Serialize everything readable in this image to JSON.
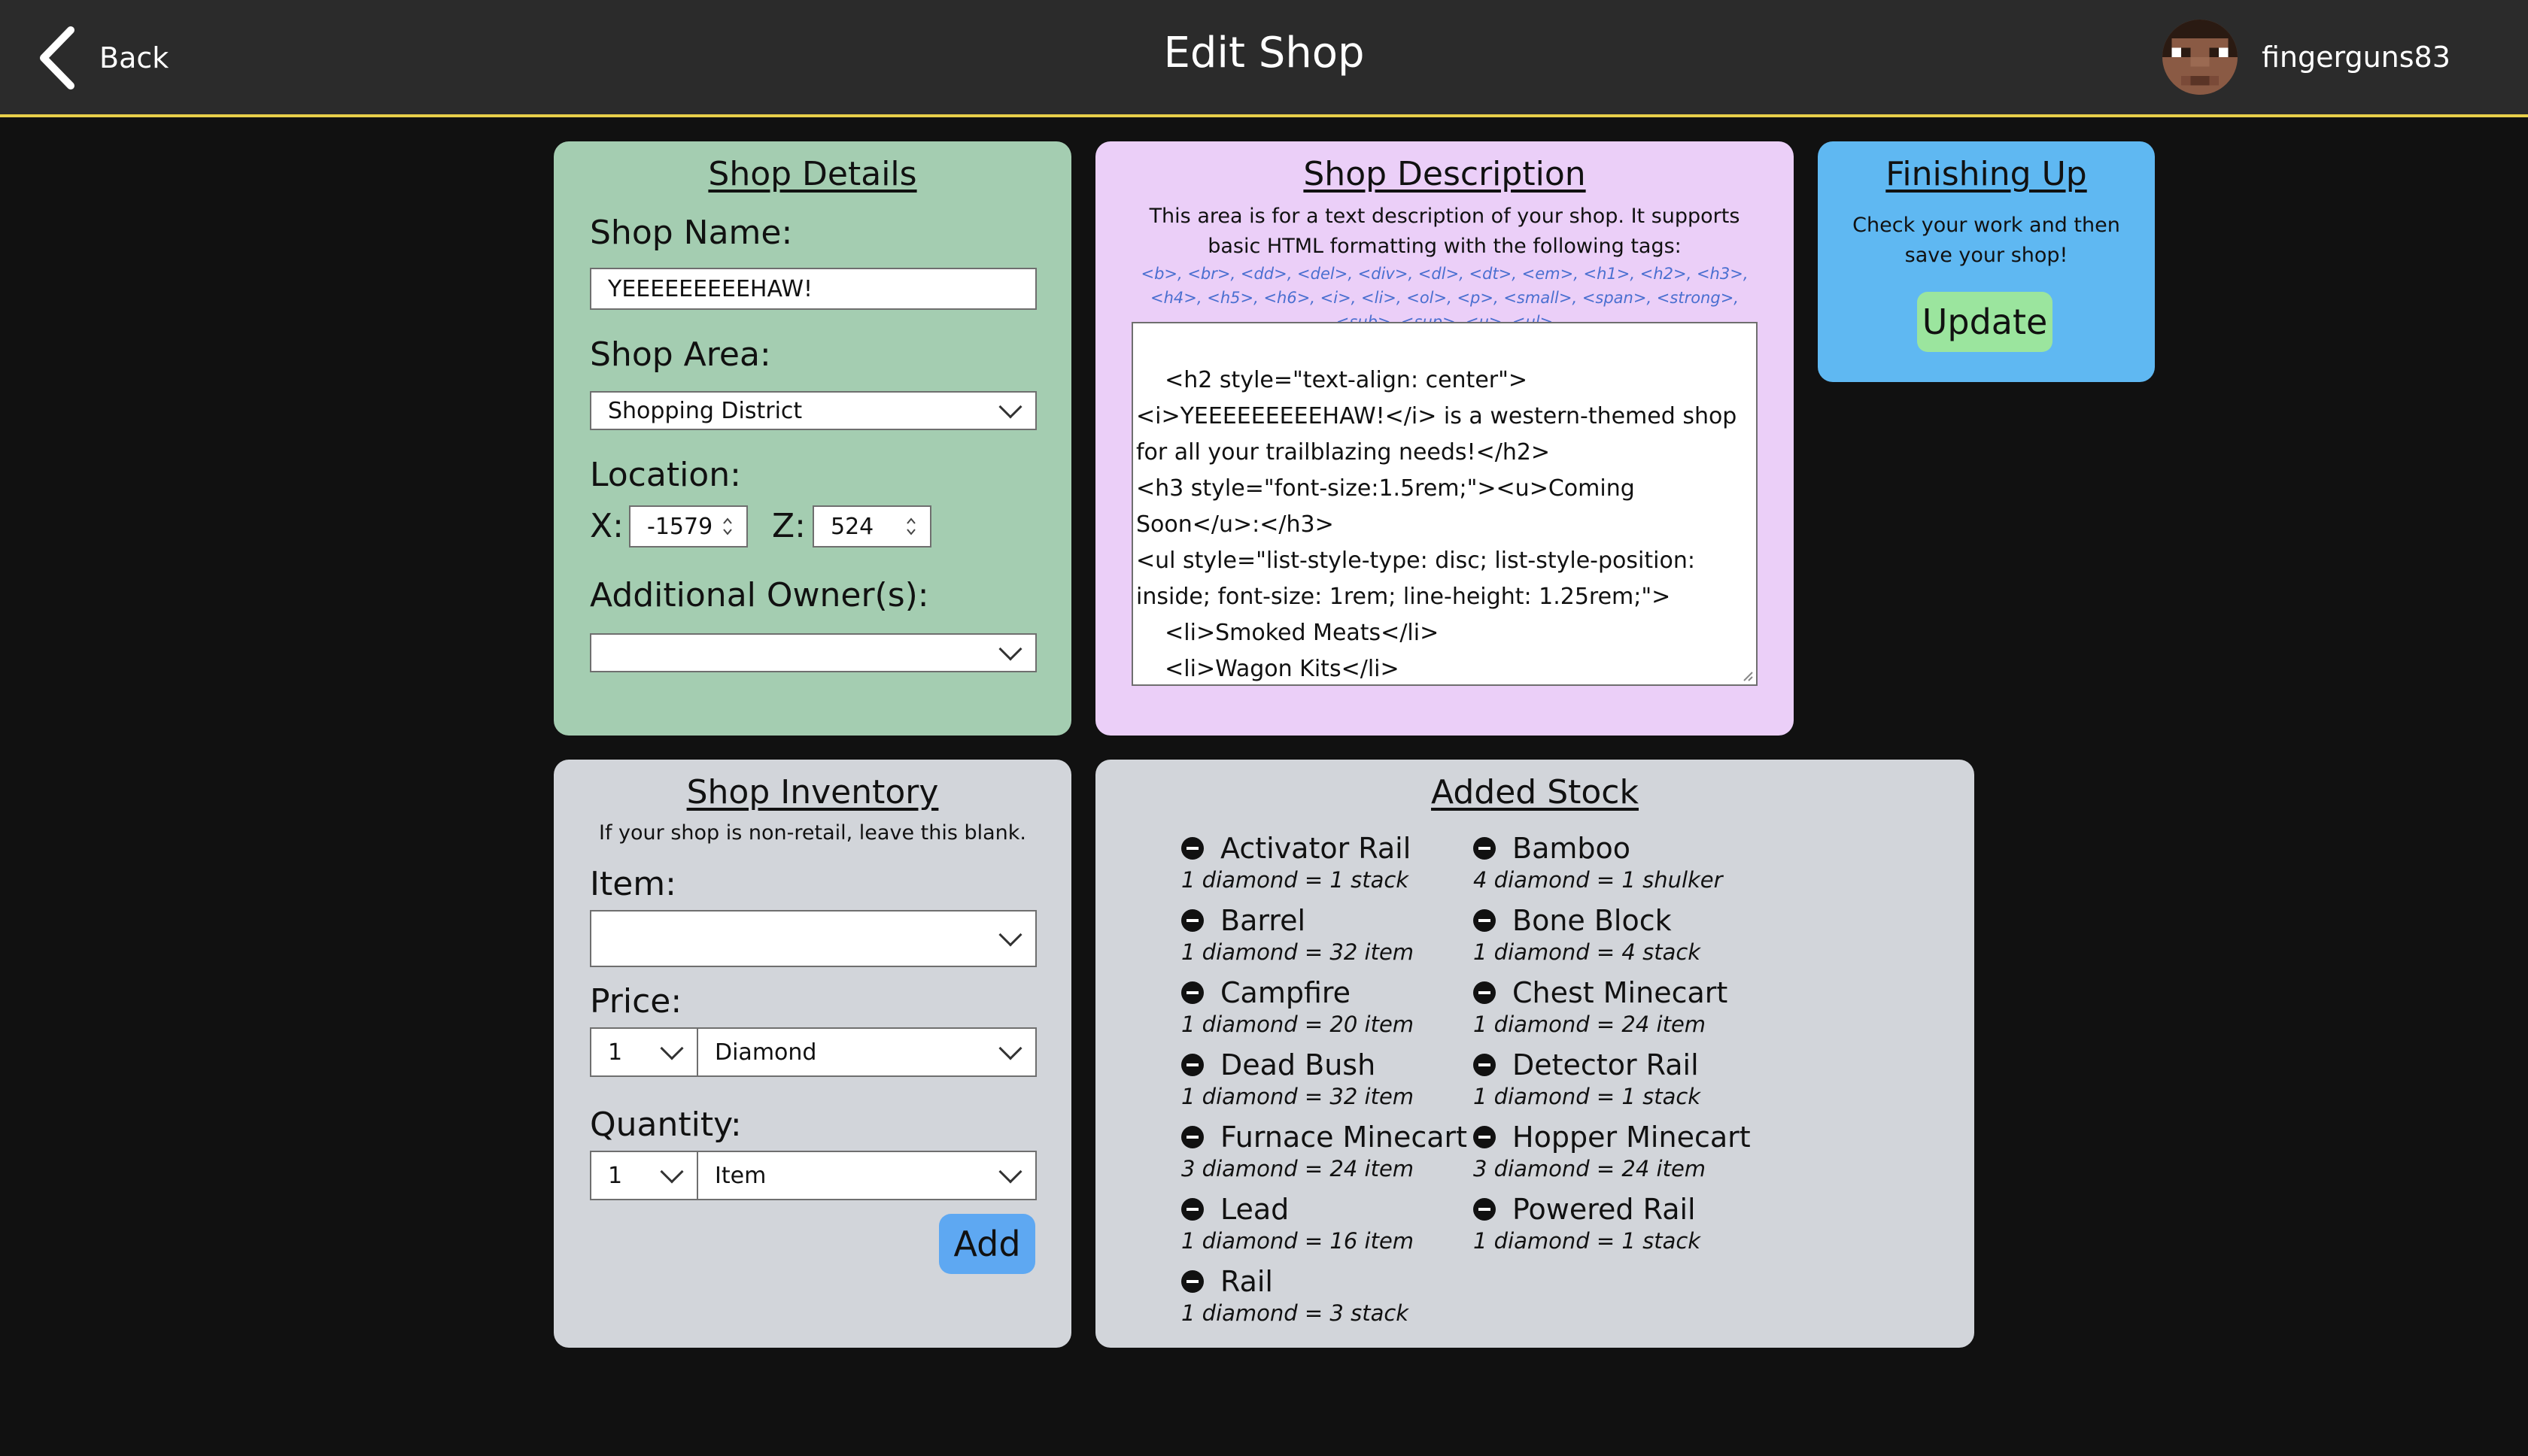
{
  "header": {
    "back_label": "Back",
    "title": "Edit Shop",
    "username": "fingerguns83"
  },
  "details": {
    "title": "Shop Details",
    "name_label": "Shop Name:",
    "name_value": "YEEEEEEEEEHAW!",
    "area_label": "Shop Area:",
    "area_value": "Shopping District",
    "location_label": "Location:",
    "x_label": "X:",
    "x_value": "-1579",
    "z_label": "Z:",
    "z_value": "524",
    "owners_label": "Additional Owner(s):",
    "owners_value": ""
  },
  "description": {
    "title": "Shop Description",
    "help": "This area is for a text description of your shop. It supports basic HTML formatting with the following tags:",
    "tags": "<b>, <br>, <dd>, <del>, <div>, <dl>, <dt>, <em>, <h1>, <h2>, <h3>, <h4>, <h5>, <h6>, <i>, <li>, <ol>, <p>, <small>, <span>, <strong>, <sub>, <sup>, <u>, <ul>",
    "text": "<h2 style=\"text-align: center\"><i>YEEEEEEEEEHAW!</i> is a western-themed shop for all your trailblazing needs!</h2>\n<h3 style=\"font-size:1.5rem;\"><u>Coming Soon</u>:</h3>\n<ul style=\"list-style-type: disc; list-style-position: inside; font-size: 1rem; line-height: 1.25rem;\">\n    <li>Smoked Meats</li>\n    <li>Wagon Kits</li>\n    <li>Cactus Boxes</li>\n</ul>"
  },
  "finishing": {
    "title": "Finishing Up",
    "help": "Check your work and then save your shop!",
    "update_label": "Update"
  },
  "inventory": {
    "title": "Shop Inventory",
    "note": "If your shop is non-retail, leave this blank.",
    "item_label": "Item:",
    "item_value": "",
    "price_label": "Price:",
    "price_qty": "1",
    "price_currency": "Diamond",
    "quantity_label": "Quantity:",
    "quantity_qty": "1",
    "quantity_unit": "Item",
    "add_label": "Add"
  },
  "stock": {
    "title": "Added Stock",
    "items": [
      {
        "name": "Activator Rail",
        "price": "1 diamond = 1 stack"
      },
      {
        "name": "Bamboo",
        "price": "4 diamond = 1 shulker"
      },
      {
        "name": "Barrel",
        "price": "1 diamond = 32 item"
      },
      {
        "name": "Bone Block",
        "price": "1 diamond = 4 stack"
      },
      {
        "name": "Campfire",
        "price": "1 diamond = 20 item"
      },
      {
        "name": "Chest Minecart",
        "price": "1 diamond = 24 item"
      },
      {
        "name": "Dead Bush",
        "price": "1 diamond = 32 item"
      },
      {
        "name": "Detector Rail",
        "price": "1 diamond = 1 stack"
      },
      {
        "name": "Furnace Minecart",
        "price": "3 diamond = 24 item"
      },
      {
        "name": "Hopper Minecart",
        "price": "3 diamond = 24 item"
      },
      {
        "name": "Lead",
        "price": "1 diamond = 16 item"
      },
      {
        "name": "Powered Rail",
        "price": "1 diamond = 1 stack"
      },
      {
        "name": "Rail",
        "price": "1 diamond = 3 stack"
      }
    ]
  },
  "colors": {
    "header_bg": "#2b2b2b",
    "header_accent": "#e8cf4a",
    "details_bg": "#a4cdb1",
    "description_bg": "#ebcff8",
    "finishing_bg": "#5fb8f2",
    "panel_bg": "#d2d5da",
    "update_button": "#9be59e",
    "add_button": "#5ea8f2"
  }
}
